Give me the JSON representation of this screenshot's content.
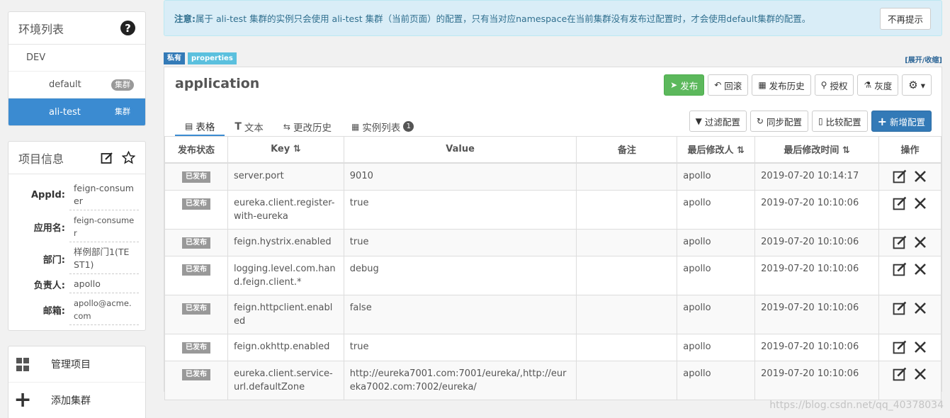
{
  "sidebar": {
    "env_title": "环境列表",
    "env": "DEV",
    "clusters": [
      {
        "name": "default",
        "badge": "集群"
      },
      {
        "name": "ali-test",
        "badge": "集群"
      }
    ],
    "info_title": "项目信息",
    "info": [
      {
        "label": "AppId:",
        "value": "feign-consumer"
      },
      {
        "label": "应用名:",
        "value": "feign-consumer"
      },
      {
        "label": "部门:",
        "value": "样例部门1(TEST1)"
      },
      {
        "label": "负责人:",
        "value": "apollo"
      },
      {
        "label": "邮箱:",
        "value": "apollo@acme.com"
      }
    ],
    "actions": [
      {
        "label": "管理项目",
        "icon": "grid-icon"
      },
      {
        "label": "添加集群",
        "icon": "plus-icon"
      }
    ]
  },
  "notice": {
    "prefix": "注意:",
    "text": "属于 ali-test 集群的实例只会使用 ali-test 集群（当前页面）的配置，只有当对应namespace在当前集群没有发布过配置时，才会使用default集群的配置。",
    "dismiss": "不再提示"
  },
  "namespace": {
    "tag_private": "私有",
    "tag_format": "properties",
    "expand": "[展开/收缩]",
    "title": "application",
    "toolbar": {
      "publish": "发布",
      "rollback": "回滚",
      "history": "发布历史",
      "auth": "授权",
      "gray": "灰度",
      "settings": "▾"
    },
    "tabs": [
      {
        "label": "表格"
      },
      {
        "label": "文本"
      },
      {
        "label": "更改历史"
      },
      {
        "label": "实例列表",
        "count": "1"
      }
    ],
    "toolbar2": {
      "filter": "过滤配置",
      "sync": "同步配置",
      "compare": "比较配置",
      "add": "新增配置"
    },
    "table": {
      "headers": [
        "发布状态",
        "Key ⇅",
        "Value",
        "备注",
        "最后修改人 ⇅",
        "最后修改时间 ⇅",
        "操作"
      ],
      "rows": [
        {
          "status": "已发布",
          "key": "server.port",
          "value": "9010",
          "comment": "",
          "user": "apollo",
          "time": "2019-07-20 10:14:17"
        },
        {
          "status": "已发布",
          "key": "eureka.client.register-with-eureka",
          "value": "true",
          "comment": "",
          "user": "apollo",
          "time": "2019-07-20 10:10:06"
        },
        {
          "status": "已发布",
          "key": "feign.hystrix.enabled",
          "value": "true",
          "comment": "",
          "user": "apollo",
          "time": "2019-07-20 10:10:06"
        },
        {
          "status": "已发布",
          "key": "logging.level.com.hand.feign.client.*",
          "value": "debug",
          "comment": "",
          "user": "apollo",
          "time": "2019-07-20 10:10:06"
        },
        {
          "status": "已发布",
          "key": "feign.httpclient.enabled",
          "value": "false",
          "comment": "",
          "user": "apollo",
          "time": "2019-07-20 10:10:06"
        },
        {
          "status": "已发布",
          "key": "feign.okhttp.enabled",
          "value": "true",
          "comment": "",
          "user": "apollo",
          "time": "2019-07-20 10:10:06"
        },
        {
          "status": "已发布",
          "key": "eureka.client.service-url.defaultZone",
          "value": "http://eureka7001.com:7001/eureka/,http://eureka7002.com:7002/eureka/",
          "comment": "",
          "user": "apollo",
          "time": "2019-07-20 10:10:06"
        }
      ]
    }
  },
  "watermark": "https://blog.csdn.net/qq_40378034"
}
